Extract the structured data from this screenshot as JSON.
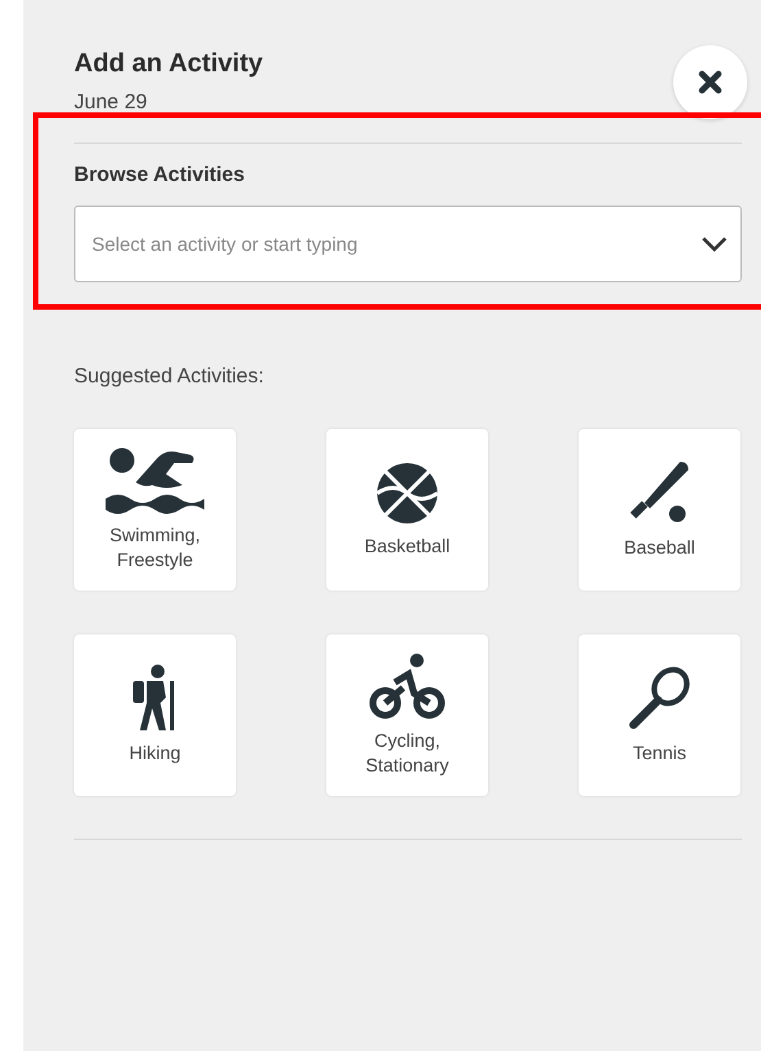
{
  "panel": {
    "title": "Add an Activity",
    "date": "June 29"
  },
  "browse": {
    "label": "Browse Activities",
    "placeholder": "Select an activity or start typing"
  },
  "suggested": {
    "heading": "Suggested Activities:",
    "items": [
      {
        "label": "Swimming, Freestyle"
      },
      {
        "label": "Basketball"
      },
      {
        "label": "Baseball"
      },
      {
        "label": "Hiking"
      },
      {
        "label": "Cycling, Stationary"
      },
      {
        "label": "Tennis"
      }
    ]
  }
}
